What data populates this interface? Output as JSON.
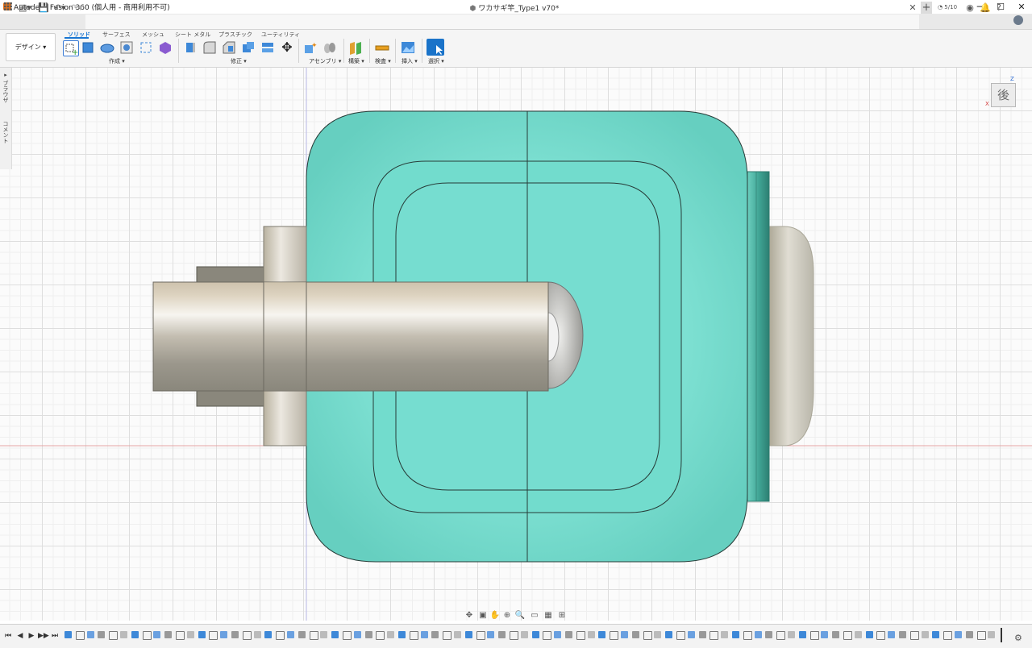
{
  "window": {
    "title": "Autodesk Fusion 360 (個人用 - 商用利用不可)",
    "controls": [
      "─",
      "☐",
      "✕"
    ]
  },
  "tabbar": {
    "grid_icon": "grid-icon",
    "file_menu": "▾",
    "document_title": "ワカサギ竿_Type1 v70*",
    "job_count": "5/10"
  },
  "toolbar": {
    "workspace": "デザイン ▾",
    "tabs": [
      "ソリッド",
      "サーフェス",
      "メッシュ",
      "シート メタル",
      "プラスチック",
      "ユーティリティ"
    ],
    "active_tab": "ソリッド",
    "groups": [
      "作成 ▾",
      "修正 ▾",
      "アセンブリ ▾",
      "構築 ▾",
      "検査 ▾",
      "挿入 ▾",
      "選択 ▾"
    ]
  },
  "browser": {
    "browser_label": "▸ ブラウザ",
    "comments_label": "コメント"
  },
  "viewcube": {
    "face": "後",
    "axis_z": "Z",
    "axis_x": "X"
  },
  "colors": {
    "teal": "#74dccd",
    "accent": "#1976d2",
    "metal": "#c8c3b8"
  },
  "timeline": {
    "controls": [
      "⏮",
      "◀",
      "▶",
      "▶▶",
      "⏭"
    ]
  }
}
